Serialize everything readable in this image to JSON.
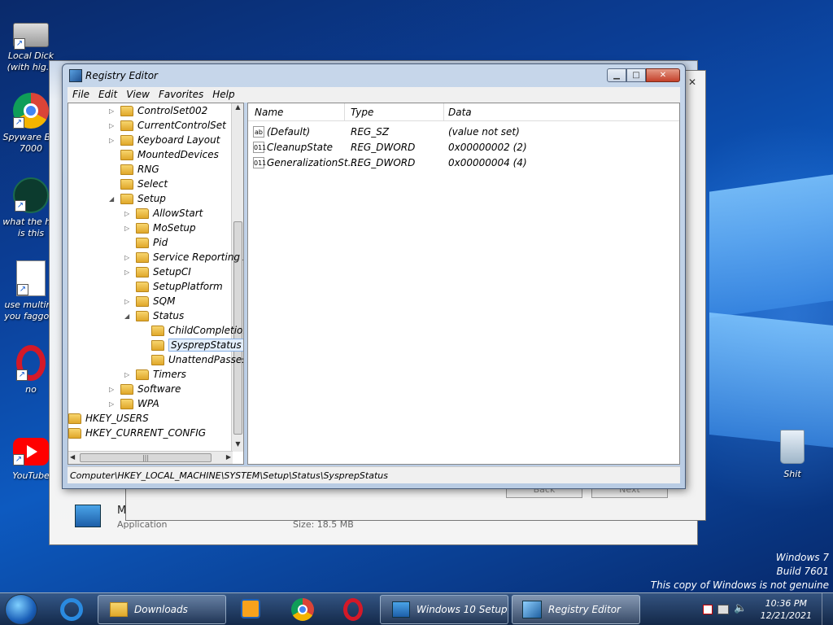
{
  "desktop": {
    "icons": [
      {
        "label": "Local Dick (with hig...",
        "icon": "drive-icon"
      },
      {
        "label": "Spyware B... 7000",
        "icon": "chrome-icon"
      },
      {
        "label": "what the h... is this",
        "icon": "app-icon"
      },
      {
        "label": "use multir... you faggo...",
        "icon": "document-icon"
      },
      {
        "label": "no",
        "icon": "opera-icon"
      },
      {
        "label": "YouTube",
        "icon": "youtube-icon"
      },
      {
        "label": "Shit",
        "icon": "recycle-bin-icon"
      }
    ],
    "watermark": [
      "Windows 7",
      "Build 7601",
      "This copy of Windows is not genuine"
    ]
  },
  "background_window": {
    "buttons": [
      "Back",
      "Next"
    ],
    "item_title": "M",
    "item_type": "Application",
    "item_size": "Size: 18.5 MB"
  },
  "registry": {
    "title": "Registry Editor",
    "caption_buttons": [
      "minimize",
      "maximize",
      "close"
    ],
    "menu": [
      "File",
      "Edit",
      "View",
      "Favorites",
      "Help"
    ],
    "tree": [
      {
        "label": "ControlSet002",
        "level": 1,
        "expander": "collapsed"
      },
      {
        "label": "CurrentControlSet",
        "level": 1,
        "expander": "collapsed"
      },
      {
        "label": "Keyboard Layout",
        "level": 1,
        "expander": "collapsed"
      },
      {
        "label": "MountedDevices",
        "level": 1,
        "expander": "none"
      },
      {
        "label": "RNG",
        "level": 1,
        "expander": "none"
      },
      {
        "label": "Select",
        "level": 1,
        "expander": "none"
      },
      {
        "label": "Setup",
        "level": 1,
        "expander": "expanded"
      },
      {
        "label": "AllowStart",
        "level": 2,
        "expander": "collapsed"
      },
      {
        "label": "MoSetup",
        "level": 2,
        "expander": "collapsed"
      },
      {
        "label": "Pid",
        "level": 2,
        "expander": "none"
      },
      {
        "label": "Service Reporting API",
        "level": 2,
        "expander": "collapsed"
      },
      {
        "label": "SetupCI",
        "level": 2,
        "expander": "collapsed"
      },
      {
        "label": "SetupPlatform",
        "level": 2,
        "expander": "none"
      },
      {
        "label": "SQM",
        "level": 2,
        "expander": "collapsed"
      },
      {
        "label": "Status",
        "level": 2,
        "expander": "expanded"
      },
      {
        "label": "ChildCompletion",
        "level": 3,
        "expander": "none"
      },
      {
        "label": "SysprepStatus",
        "level": 3,
        "expander": "none",
        "selected": true
      },
      {
        "label": "UnattendPasses",
        "level": 3,
        "expander": "none"
      },
      {
        "label": "Timers",
        "level": 2,
        "expander": "collapsed"
      },
      {
        "label": "Software",
        "level": 1,
        "expander": "collapsed"
      },
      {
        "label": "WPA",
        "level": 1,
        "expander": "collapsed"
      },
      {
        "label": "HKEY_USERS",
        "level": 0,
        "expander": "collapsed"
      },
      {
        "label": "HKEY_CURRENT_CONFIG",
        "level": 0,
        "expander": "collapsed"
      }
    ],
    "columns": [
      "Name",
      "Type",
      "Data"
    ],
    "values": [
      {
        "name": "(Default)",
        "type": "REG_SZ",
        "data": "(value not set)",
        "icon": "string-value-icon",
        "glyph": "ab"
      },
      {
        "name": "CleanupState",
        "type": "REG_DWORD",
        "data": "0x00000002 (2)",
        "icon": "binary-value-icon",
        "glyph": "011"
      },
      {
        "name": "GeneralizationSt...",
        "type": "REG_DWORD",
        "data": "0x00000004 (4)",
        "icon": "binary-value-icon",
        "glyph": "011"
      }
    ],
    "status_path": "Computer\\HKEY_LOCAL_MACHINE\\SYSTEM\\Setup\\Status\\SysprepStatus"
  },
  "taskbar": {
    "buttons": [
      {
        "label": "Downloads",
        "icon": "folder-icon"
      },
      {
        "label": "Windows 10 Setup",
        "icon": "setup-icon"
      },
      {
        "label": "Registry Editor",
        "icon": "regedit-icon"
      }
    ],
    "pinned": [
      "internet-explorer-icon",
      "media-player-icon",
      "chrome-icon",
      "opera-icon"
    ],
    "time": "10:36 PM",
    "date": "12/21/2021"
  }
}
